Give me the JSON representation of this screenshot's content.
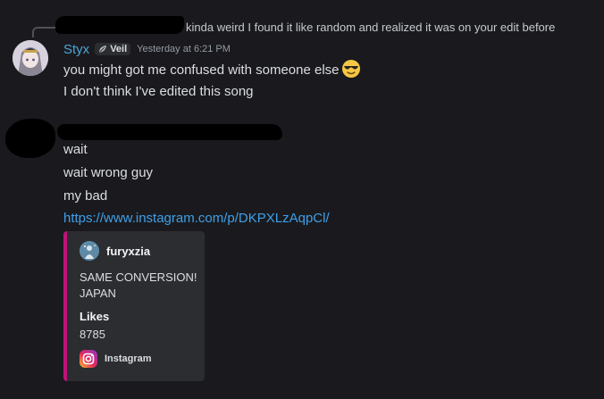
{
  "reply": {
    "text": "kinda weird I found it like random and realized it was on your edit before"
  },
  "message1": {
    "username": "Styx",
    "tag": "Veil",
    "timestamp": "Yesterday at 6:21 PM",
    "lines": [
      "you might got me confused with someone else",
      "I don't think I've edited this song"
    ],
    "emoji": "sunglasses-emoji"
  },
  "message2": {
    "lines": [
      "wait",
      "wait wrong guy",
      "my bad"
    ],
    "link": "https://www.instagram.com/p/DKPXLzAqpCl/"
  },
  "embed": {
    "accent_color": "#c1127a",
    "author": "furyxzia",
    "description_lines": [
      "SAME CONVERSION!",
      "JAPAN"
    ],
    "field_name": "Likes",
    "field_value": "8785",
    "footer": "Instagram"
  },
  "colors": {
    "background": "#1a1a1e",
    "username": "#4aa6d9",
    "link": "#3ea0e8"
  }
}
